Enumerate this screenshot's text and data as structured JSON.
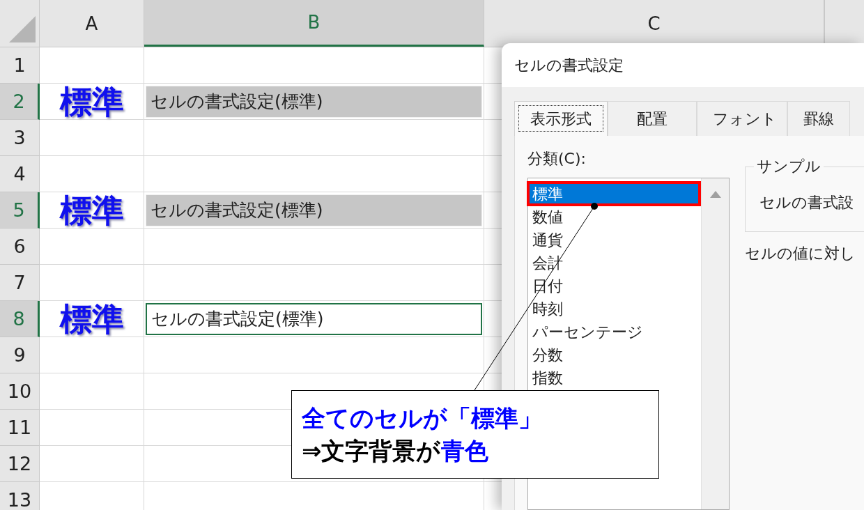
{
  "sheet": {
    "columns": [
      {
        "label": "A",
        "selected": false
      },
      {
        "label": "B",
        "selected": true
      },
      {
        "label": "C",
        "selected": false
      }
    ],
    "rows": [
      {
        "label": "1",
        "selected": false
      },
      {
        "label": "2",
        "selected": true,
        "cell_a": "標準",
        "cell_b": {
          "text": "セルの書式設定(標準)",
          "kind": "selected"
        }
      },
      {
        "label": "3",
        "selected": false
      },
      {
        "label": "4",
        "selected": false
      },
      {
        "label": "5",
        "selected": true,
        "cell_a": "標準",
        "cell_b": {
          "text": "セルの書式設定(標準)",
          "kind": "selected"
        }
      },
      {
        "label": "6",
        "selected": false
      },
      {
        "label": "7",
        "selected": false
      },
      {
        "label": "8",
        "selected": true,
        "cell_a": "標準",
        "cell_b": {
          "text": "セルの書式設定(標準)",
          "kind": "active"
        }
      },
      {
        "label": "9",
        "selected": false
      },
      {
        "label": "10",
        "selected": false
      },
      {
        "label": "11",
        "selected": false
      },
      {
        "label": "12",
        "selected": false
      },
      {
        "label": "13",
        "selected": false
      }
    ]
  },
  "dialog": {
    "title": "セルの書式設定",
    "tabs": [
      {
        "label": "表示形式",
        "selected": true
      },
      {
        "label": "配置",
        "selected": false
      },
      {
        "label": "フォント",
        "selected": false
      },
      {
        "label": "罫線",
        "selected": false
      }
    ],
    "category_label": "分類(C):",
    "categories": [
      {
        "label": "標準",
        "selected": true
      },
      {
        "label": "数値",
        "selected": false
      },
      {
        "label": "通貨",
        "selected": false
      },
      {
        "label": "会計",
        "selected": false
      },
      {
        "label": "日付",
        "selected": false
      },
      {
        "label": "時刻",
        "selected": false
      },
      {
        "label": "パーセンテージ",
        "selected": false
      },
      {
        "label": "分数",
        "selected": false
      },
      {
        "label": "指数",
        "selected": false
      }
    ],
    "sample": {
      "legend": "サンプル",
      "value": "セルの書式設"
    },
    "description": "セルの値に対し"
  },
  "callout": {
    "highlight_selected": true,
    "lines": [
      [
        {
          "text": "全てのセルが「標準」",
          "color": "#0000ff"
        }
      ],
      [
        {
          "text": "⇒文字背景が",
          "color": "#000000"
        },
        {
          "text": "青色",
          "color": "#0000ff"
        }
      ]
    ]
  }
}
